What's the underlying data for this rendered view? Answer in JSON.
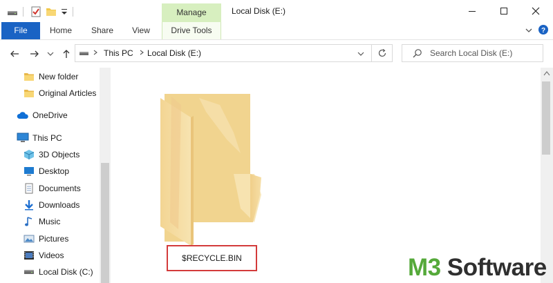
{
  "window": {
    "title": "Local Disk (E:)",
    "context_tab_group": "Manage"
  },
  "ribbon": {
    "tabs": [
      {
        "label": "File"
      },
      {
        "label": "Home"
      },
      {
        "label": "Share"
      },
      {
        "label": "View"
      },
      {
        "label": "Drive Tools"
      }
    ]
  },
  "address": {
    "breadcrumb": [
      "This PC",
      "Local Disk (E:)"
    ]
  },
  "search": {
    "placeholder": "Search Local Disk (E:)"
  },
  "nav_pane": {
    "items": [
      {
        "label": "New folder",
        "icon": "folder-icon"
      },
      {
        "label": "Original Articles",
        "icon": "folder-icon"
      },
      {
        "label": "OneDrive",
        "icon": "onedrive-cloud-icon"
      },
      {
        "label": "This PC",
        "icon": "computer-icon"
      },
      {
        "label": "3D Objects",
        "icon": "3d-objects-icon"
      },
      {
        "label": "Desktop",
        "icon": "desktop-icon"
      },
      {
        "label": "Documents",
        "icon": "documents-icon"
      },
      {
        "label": "Downloads",
        "icon": "downloads-icon"
      },
      {
        "label": "Music",
        "icon": "music-icon"
      },
      {
        "label": "Pictures",
        "icon": "pictures-icon"
      },
      {
        "label": "Videos",
        "icon": "videos-icon"
      },
      {
        "label": "Local Disk (C:)",
        "icon": "drive-icon"
      }
    ]
  },
  "content": {
    "items": [
      {
        "name": "$RECYCLE.BIN",
        "icon": "folder-icon",
        "highlighted": true
      }
    ]
  },
  "watermark": {
    "part1": "M3",
    "part2": " Software"
  },
  "colors": {
    "file_tab": "#1a63c4",
    "manage_tab": "#d7efbf",
    "highlight_border": "#d33a3a",
    "watermark_green": "#55a93a"
  }
}
